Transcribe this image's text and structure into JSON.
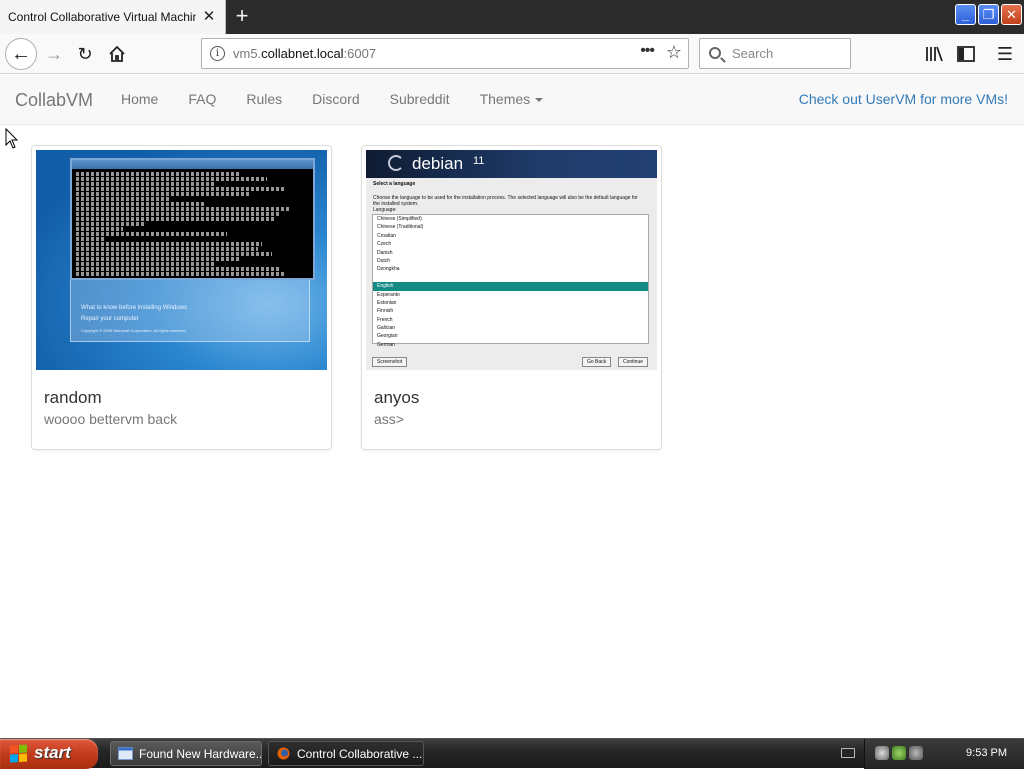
{
  "browser": {
    "tab_title": "Control Collaborative Virtual Machines!",
    "tab_close_glyph": "✕",
    "newtab_glyph": "+",
    "window_buttons": [
      "minimize-icon",
      "restore-icon",
      "close-icon"
    ],
    "url": {
      "host_prefix": "vm5.",
      "host_main": "collabnet.local",
      "port": ":6007"
    },
    "search_placeholder": "Search",
    "nav_icons": [
      "back-icon",
      "forward-icon",
      "reload-icon",
      "home-icon",
      "library-icon",
      "sidebar-icon",
      "menu-icon"
    ]
  },
  "site": {
    "brand": "CollabVM",
    "nav_links": [
      "Home",
      "FAQ",
      "Rules",
      "Discord",
      "Subreddit",
      "Themes"
    ],
    "promo": "Check out UserVM for more VMs!"
  },
  "vms": [
    {
      "title": "random",
      "description": "woooo bettervm back"
    },
    {
      "title": "anyos",
      "description": "ass>"
    }
  ],
  "thumbnails": {
    "win7": {
      "setup_lines": [
        "What to know before installing Windows",
        "Repair your computer",
        "Copyright © 2009 Microsoft Corporation. All rights reserved."
      ]
    },
    "debian": {
      "word": "debian",
      "version": "11",
      "heading": "Select a language",
      "prompt": "Choose the language to be used for the installation process. The selected language will also be the default language for the installed system.",
      "list_label": "Language:",
      "languages": [
        "Chinese (Simplified)",
        "Chinese (Traditional)",
        "Croatian",
        "Czech",
        "Danish",
        "Dutch",
        "Dzongkha",
        "",
        "English",
        "Esperanto",
        "Estonian",
        "Finnish",
        "French",
        "Galician",
        "Georgian",
        "German"
      ],
      "selected": "English",
      "buttons": {
        "screenshot": "Screenshot",
        "back": "Go Back",
        "continue": "Continue"
      }
    }
  },
  "taskbar": {
    "start_label": "start",
    "tasks": [
      "Found New Hardware...",
      "Control Collaborative ..."
    ],
    "clock": "9:53 PM"
  },
  "colors": {
    "link": "#337ab7",
    "debian_select": "#138a83",
    "xp_start": "#c23b1c"
  }
}
